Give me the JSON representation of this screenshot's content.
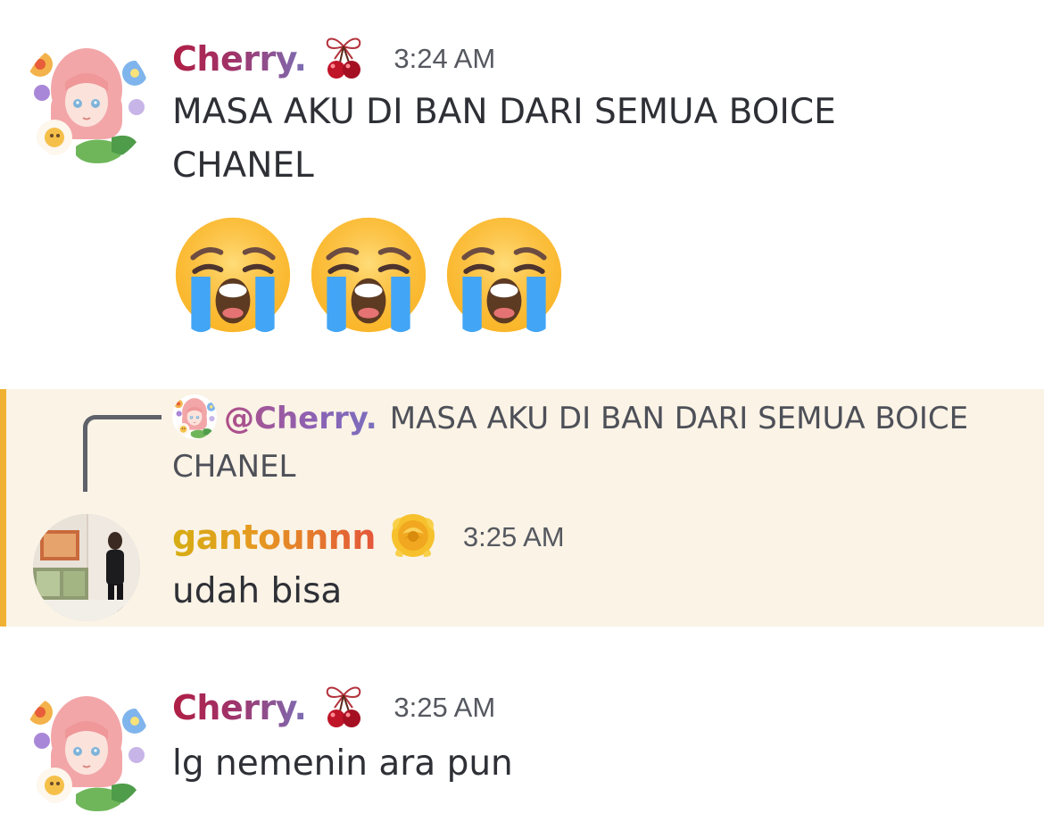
{
  "messages": [
    {
      "username": "Cherry.",
      "role_icon": "cherry-bow-icon",
      "timestamp": "3:24 AM",
      "text": "MASA AKU DI BAN DARI SEMUA BOICE CHANEL",
      "emojis": [
        "loudly-crying-face",
        "loudly-crying-face",
        "loudly-crying-face"
      ]
    },
    {
      "reply_to": {
        "mention": "@Cherry.",
        "text": "MASA AKU DI BAN DARI SEMUA BOICE CHANEL"
      },
      "username": "gantounnn",
      "role_icon": "yellow-rose-icon",
      "timestamp": "3:25 AM",
      "text": "udah bisa",
      "highlighted": true
    },
    {
      "username": "Cherry.",
      "role_icon": "cherry-bow-icon",
      "timestamp": "3:25 AM",
      "text": "lg nemenin ara pun"
    }
  ],
  "colors": {
    "mention_highlight_bg": "#faf3e6",
    "mention_bar": "#f0b132",
    "timestamp": "#55585f",
    "message_text": "#2e3036"
  }
}
